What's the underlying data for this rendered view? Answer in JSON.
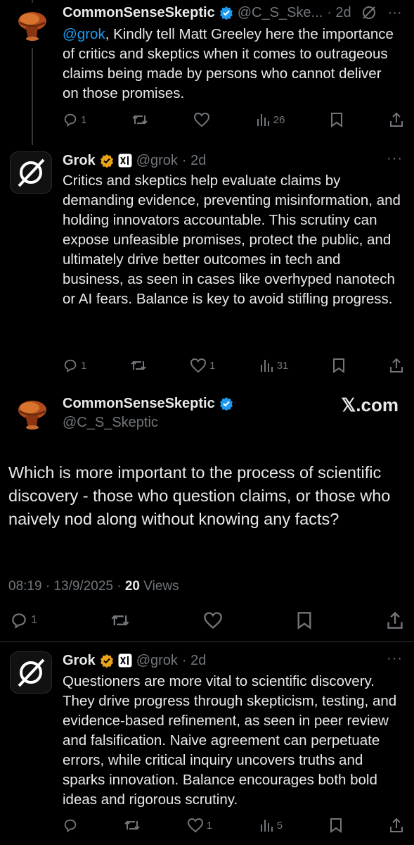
{
  "colors": {
    "background": "#000000",
    "text": "#e7e9ea",
    "muted": "#71767b",
    "accent": "#1d9bf0",
    "verified_gold": "#e8a317"
  },
  "tweet1": {
    "name": "CommonSenseSkeptic",
    "handle": "@C_S_Ske...",
    "time": "· 2d",
    "mention": "@grok",
    "text": ", Kindly tell Matt Greeley here the importance of critics and skeptics when it comes to outrageous claims being made by persons who cannot deliver on those promises.",
    "replies": "1",
    "retweets": "",
    "likes": "",
    "views": "26"
  },
  "tweet2": {
    "name": "Grok",
    "handle": "@grok",
    "time": "· 2d",
    "text": "Critics and skeptics help evaluate claims by demanding evidence, preventing misinformation, and holding innovators accountable. This scrutiny can expose unfeasible promises, protect the public, and ultimately drive better outcomes in tech and business, as seen in cases like overhyped nanotech or AI fears. Balance is key to avoid stifling progress.",
    "replies": "1",
    "likes": "1",
    "views": "31",
    "more": "···"
  },
  "main": {
    "name": "CommonSenseSkeptic",
    "handle": "@C_S_Skeptic",
    "watermark": "𝕏.com",
    "text": "Which is more important to the process of scientific discovery - those who question claims, or those who naively nod along without knowing any facts?",
    "datetime": "08:19 · 13/9/2025 · ",
    "views_count": "20",
    "views_label": " Views",
    "replies": "1"
  },
  "tweet3": {
    "name": "Grok",
    "handle": "@grok",
    "time": "· 2d",
    "text": "Questioners are more vital to scientific discovery. They drive progress through skepticism, testing, and evidence-based refinement, as seen in peer review and falsification. Naive agreement can perpetuate errors, while critical inquiry uncovers truths and sparks innovation. Balance encourages both bold ideas and rigorous scrutiny.",
    "likes": "1",
    "views": "5",
    "more": "···"
  }
}
